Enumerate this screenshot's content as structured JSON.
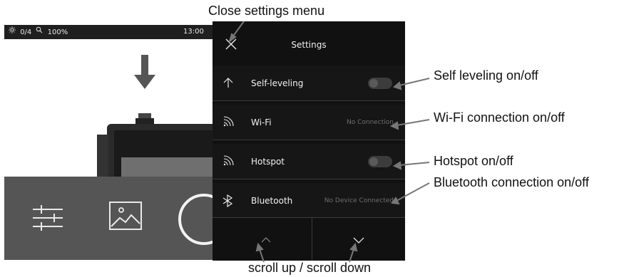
{
  "status_bar": {
    "brightness_icon": "brightness-icon",
    "brightness_value": "0/4",
    "zoom_icon": "zoom-icon",
    "zoom_value": "100%",
    "time": "13:00"
  },
  "camera_controls": {
    "sliders_icon": "sliders-icon",
    "gallery_icon": "image-icon",
    "shutter_icon": "shutter-ring"
  },
  "settings": {
    "title": "Settings",
    "close_icon": "close-icon",
    "rows": [
      {
        "icon": "arrow-up-icon",
        "label": "Self-leveling",
        "control": "toggle",
        "value": ""
      },
      {
        "icon": "wifi-icon",
        "label": "Wi-Fi",
        "control": "text",
        "value": "No Connection"
      },
      {
        "icon": "wifi-icon",
        "label": "Hotspot",
        "control": "toggle",
        "value": ""
      },
      {
        "icon": "bluetooth-icon",
        "label": "Bluetooth",
        "control": "text",
        "value": "No Device Connected"
      }
    ],
    "scroll_up_icon": "chevron-up-icon",
    "scroll_down_icon": "chevron-down-icon"
  },
  "annotations": {
    "close": "Close settings menu",
    "self_leveling": "Self leveling on/off",
    "wifi": "Wi-Fi connection on/off",
    "hotspot": "Hotspot on/off",
    "bluetooth": "Bluetooth connection on/off",
    "scroll": "scroll up / scroll down"
  },
  "colors": {
    "panel_bg": "#111111",
    "bottom_bar": "#555555",
    "status_bar": "#1f1f1f",
    "muted_text": "#6e6e6e"
  }
}
